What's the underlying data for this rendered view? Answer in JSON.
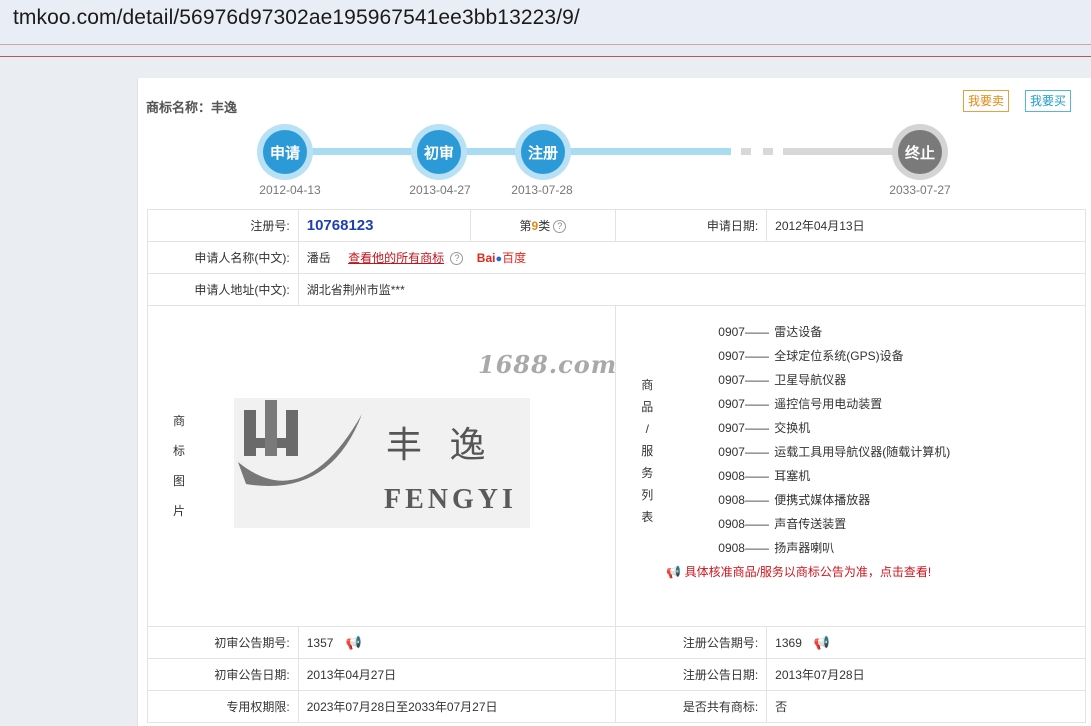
{
  "browser": {
    "url": "tmkoo.com/detail/56976d97302ae195967541ee3bb13223/9/"
  },
  "trademark": {
    "title": "商标名称：丰逸",
    "sell_label": "我要卖",
    "buy_label": "我要买"
  },
  "timeline": {
    "steps": [
      {
        "label": "申请",
        "date": "2012-04-13"
      },
      {
        "label": "初审",
        "date": "2013-04-27"
      },
      {
        "label": "注册",
        "date": "2013-07-28"
      },
      {
        "label": "终止",
        "date": "2033-07-27"
      }
    ]
  },
  "details": {
    "reg_no_label": "注册号:",
    "reg_no": "10768123",
    "class_prefix": "第",
    "class_num": "9",
    "class_suffix": "类",
    "apply_date_label": "申请日期:",
    "apply_date": "2012年04月13日",
    "applicant_label": "申请人名称(中文):",
    "applicant": "潘岳",
    "view_all_link": "查看他的所有商标",
    "baidu_bai": "Bai",
    "baidu_du": "百度",
    "address_label": "申请人地址(中文):",
    "address": "湖北省荆州市监***",
    "image_label_chars": [
      "商",
      "标",
      "图",
      "片"
    ],
    "goods_label_chars": [
      "商",
      "品",
      "/",
      "服",
      "务",
      "列",
      "表"
    ],
    "watermark": "1688.com",
    "logo_cn": "丰 逸",
    "logo_en": "FENGYI",
    "goods": [
      {
        "code": "0907——",
        "name": "雷达设备"
      },
      {
        "code": "0907——",
        "name": "全球定位系统(GPS)设备"
      },
      {
        "code": "0907——",
        "name": "卫星导航仪器"
      },
      {
        "code": "0907——",
        "name": "遥控信号用电动装置"
      },
      {
        "code": "0907——",
        "name": "交换机"
      },
      {
        "code": "0907——",
        "name": "运载工具用导航仪器(随载计算机)"
      },
      {
        "code": "0908——",
        "name": "耳塞机"
      },
      {
        "code": "0908——",
        "name": "便携式媒体播放器"
      },
      {
        "code": "0908——",
        "name": "声音传送装置"
      },
      {
        "code": "0908——",
        "name": "扬声器喇叭"
      }
    ],
    "goods_notice": "具体核准商品/服务以商标公告为准，点击查看!",
    "prelim_no_label": "初审公告期号:",
    "prelim_no": "1357",
    "reg_pub_no_label": "注册公告期号:",
    "reg_pub_no": "1369",
    "prelim_date_label": "初审公告日期:",
    "prelim_date": "2013年04月27日",
    "reg_pub_date_label": "注册公告日期:",
    "reg_pub_date": "2013年07月28日",
    "exclusive_label": "专用权期限:",
    "exclusive": "2023年07月28日至2033年07月27日",
    "shared_label": "是否共有商标:",
    "shared": "否"
  },
  "colors": {
    "step_active": "#2c9ad6",
    "step_ended": "#7a7a7a",
    "reg_no": "#1f3fb5",
    "link_red": "#c0141b"
  }
}
